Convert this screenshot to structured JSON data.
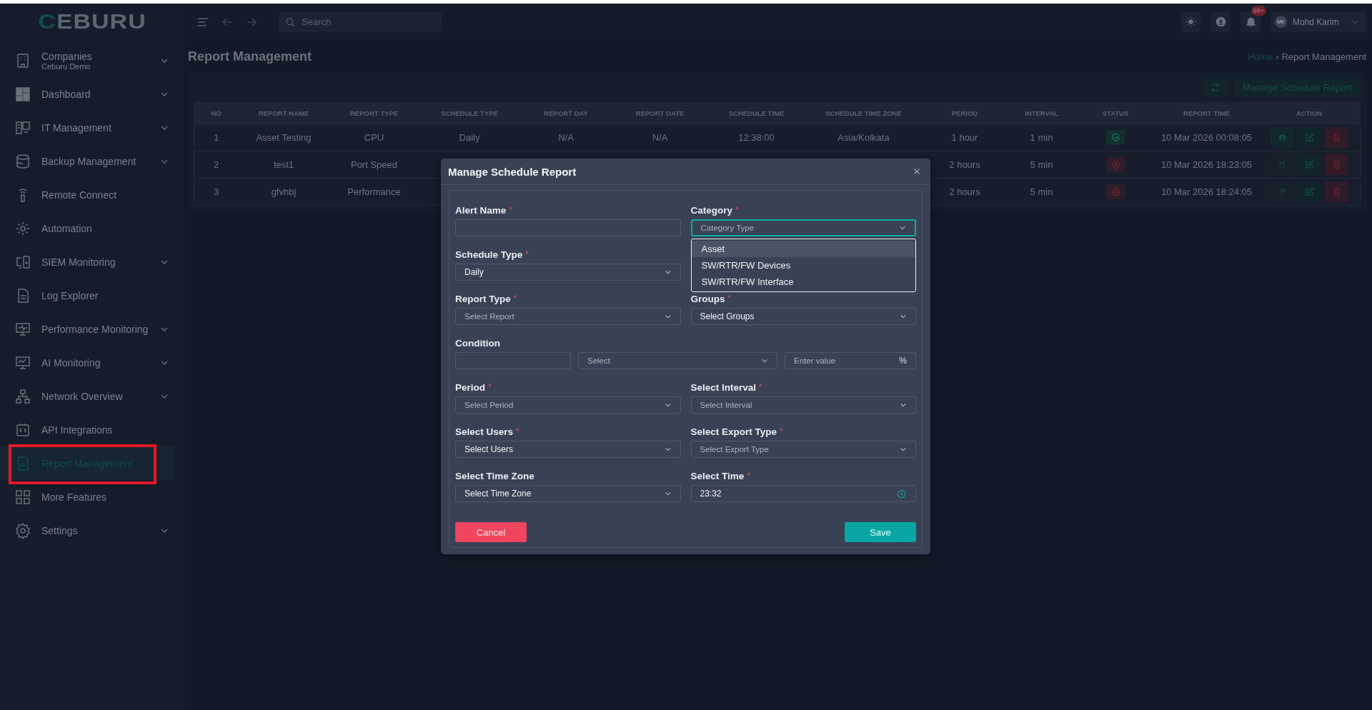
{
  "logo": "CEBURU",
  "search": {
    "placeholder": "Search"
  },
  "topbar": {
    "notifications_badge": "99+",
    "user": {
      "initials": "MK",
      "name": "Mohd Karim"
    }
  },
  "sidebar": {
    "items": [
      {
        "label": "Companies",
        "sublabel": "Ceburu Demo",
        "expandable": true,
        "selected": false
      },
      {
        "label": "Dashboard",
        "expandable": true,
        "selected": false
      },
      {
        "label": "IT Management",
        "expandable": true,
        "selected": false
      },
      {
        "label": "Backup Management",
        "expandable": true,
        "selected": false
      },
      {
        "label": "Remote Connect",
        "expandable": false,
        "selected": false
      },
      {
        "label": "Automation",
        "expandable": false,
        "selected": false
      },
      {
        "label": "SIEM Monitoring",
        "expandable": true,
        "selected": false
      },
      {
        "label": "Log Explorer",
        "expandable": false,
        "selected": false
      },
      {
        "label": "Performance Monitoring",
        "expandable": true,
        "selected": false
      },
      {
        "label": "AI Monitoring",
        "expandable": true,
        "selected": false
      },
      {
        "label": "Network Overview",
        "expandable": true,
        "selected": false
      },
      {
        "label": "API Integrations",
        "expandable": false,
        "selected": false
      },
      {
        "label": "Report Management",
        "expandable": false,
        "selected": true
      },
      {
        "label": "More Features",
        "expandable": false,
        "selected": false
      },
      {
        "label": "Settings",
        "expandable": true,
        "selected": false
      }
    ]
  },
  "page": {
    "title": "Report Management",
    "breadcrumb": [
      {
        "label": "Home",
        "link": true
      },
      {
        "label": "›",
        "link": false
      },
      {
        "label": "Report Management",
        "link": false
      }
    ],
    "manage_button": "Manage Schedule Report"
  },
  "table": {
    "columns": [
      "NO",
      "REPORT NAME",
      "REPORT TYPE",
      "SCHEDULE TYPE",
      "REPORT DAY",
      "REPORT DATE",
      "SCHEDULE TIME",
      "SCHEDULE TIME ZONE",
      "PERIOD",
      "INTERVAL",
      "STATUS",
      "REPORT TIME",
      "ACTION"
    ],
    "rows": [
      {
        "no": "1",
        "report_name": "Asset Testing",
        "report_type": "CPU",
        "schedule_type": "Daily",
        "report_day": "N/A",
        "report_date": "N/A",
        "schedule_time": "12:38:00",
        "time_zone": "Asia/Kolkata",
        "period": "1 hour",
        "interval": "1 min",
        "success": true,
        "report_time": "10 Mar 2026 00:08:05",
        "download_enabled": true
      },
      {
        "no": "2",
        "report_name": "test1",
        "report_type": "Port Speed",
        "period": "2 hours",
        "interval": "5 min",
        "success": false,
        "report_time": "10 Mar 2026 18:23:05",
        "download_enabled": false
      },
      {
        "no": "3",
        "report_name": "gfvhbj",
        "report_type": "Performance",
        "period": "2 hours",
        "interval": "5 min",
        "success": false,
        "report_time": "10 Mar 2026 18:24:05",
        "download_enabled": false
      }
    ]
  },
  "modal": {
    "title": "Manage Schedule Report",
    "rows": [
      [
        {
          "kind": "text",
          "label": "Alert Name",
          "required_mark": "*"
        },
        {
          "kind": "select",
          "label": "Category",
          "required_mark": "*",
          "placeholder": "Category Type",
          "focused": true
        }
      ],
      [
        {
          "kind": "select",
          "label": "Schedule Type",
          "required_mark": "*",
          "value": "Daily"
        }
      ],
      [
        {
          "kind": "select",
          "label": "Report Type",
          "required_mark": "*",
          "placeholder": "Select Report"
        },
        {
          "kind": "select",
          "label": "Groups",
          "required_mark": "*",
          "value": "Select Groups"
        }
      ],
      [
        {
          "kind": "condition",
          "label": "Condition",
          "select_placeholder": "Select",
          "value_placeholder": "Enter value",
          "suffix": "%"
        }
      ],
      [
        {
          "kind": "select",
          "label": "Period",
          "required_mark": "*",
          "placeholder": "Select Period"
        },
        {
          "kind": "select",
          "label": "Select Interval",
          "required_mark": "*",
          "placeholder": "Select Interval"
        }
      ],
      [
        {
          "kind": "select",
          "label": "Select Users",
          "required_mark": "*",
          "value": "Select Users"
        },
        {
          "kind": "select",
          "label": "Select Export Type",
          "required_mark": "*",
          "placeholder": "Select Export Type"
        }
      ],
      [
        {
          "kind": "select",
          "label": "Select Time Zone",
          "value": "Select Time Zone"
        },
        {
          "kind": "time",
          "label": "Select Time",
          "required_mark": "*",
          "value": "23:32"
        }
      ]
    ],
    "dropdown_options": [
      {
        "label": "Asset",
        "selected": true
      },
      {
        "label": "SW/RTR/FW Devices",
        "selected": false
      },
      {
        "label": "SW/RTR/FW Interface",
        "selected": false
      }
    ],
    "buttons": {
      "cancel": "Cancel",
      "save": "Save"
    }
  }
}
